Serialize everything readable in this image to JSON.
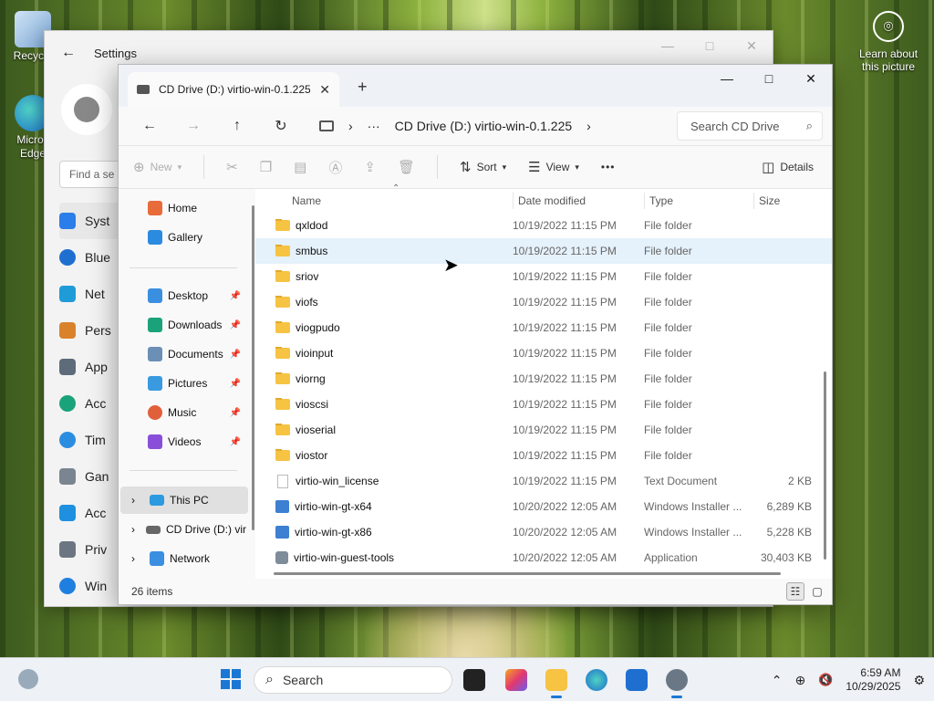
{
  "desktop": {
    "recycle_label": "Recycle",
    "edge_label": "Micros\nEdge",
    "learn_label": "Learn about this picture"
  },
  "settings": {
    "title": "Settings",
    "search_placeholder": "Find a se",
    "nav": [
      "Syst",
      "Blue",
      "Net",
      "Pers",
      "App",
      "Acc",
      "Tim",
      "Gan",
      "Acc",
      "Priv",
      "Win"
    ],
    "controls": [
      "—",
      "□",
      "✕"
    ]
  },
  "explorer": {
    "tab_title": "CD Drive (D:) virtio-win-0.1.225",
    "tab_close": "✕",
    "new_tab": "+",
    "controls": [
      "—",
      "□",
      "✕"
    ],
    "address": {
      "ellipsis": "···",
      "crumb": "CD Drive (D:) virtio-win-0.1.225",
      "search_placeholder": "Search CD Drive"
    },
    "toolbar": {
      "new": "New",
      "sort": "Sort",
      "view": "View",
      "more": "•••",
      "details": "Details"
    },
    "sidebar": {
      "home": "Home",
      "gallery": "Gallery",
      "desktop": "Desktop",
      "downloads": "Downloads",
      "documents": "Documents",
      "pictures": "Pictures",
      "music": "Music",
      "videos": "Videos",
      "this_pc": "This PC",
      "cd_drive": "CD Drive (D:) vir",
      "network": "Network"
    },
    "columns": {
      "name": "Name",
      "date": "Date modified",
      "type": "Type",
      "size": "Size"
    },
    "files": [
      {
        "name": "qxldod",
        "date": "10/19/2022 11:15 PM",
        "type": "File folder",
        "size": "",
        "kind": "folder"
      },
      {
        "name": "smbus",
        "date": "10/19/2022 11:15 PM",
        "type": "File folder",
        "size": "",
        "kind": "folder"
      },
      {
        "name": "sriov",
        "date": "10/19/2022 11:15 PM",
        "type": "File folder",
        "size": "",
        "kind": "folder"
      },
      {
        "name": "viofs",
        "date": "10/19/2022 11:15 PM",
        "type": "File folder",
        "size": "",
        "kind": "folder"
      },
      {
        "name": "viogpudo",
        "date": "10/19/2022 11:15 PM",
        "type": "File folder",
        "size": "",
        "kind": "folder"
      },
      {
        "name": "vioinput",
        "date": "10/19/2022 11:15 PM",
        "type": "File folder",
        "size": "",
        "kind": "folder"
      },
      {
        "name": "viorng",
        "date": "10/19/2022 11:15 PM",
        "type": "File folder",
        "size": "",
        "kind": "folder"
      },
      {
        "name": "vioscsi",
        "date": "10/19/2022 11:15 PM",
        "type": "File folder",
        "size": "",
        "kind": "folder"
      },
      {
        "name": "vioserial",
        "date": "10/19/2022 11:15 PM",
        "type": "File folder",
        "size": "",
        "kind": "folder"
      },
      {
        "name": "viostor",
        "date": "10/19/2022 11:15 PM",
        "type": "File folder",
        "size": "",
        "kind": "folder"
      },
      {
        "name": "virtio-win_license",
        "date": "10/19/2022 11:15 PM",
        "type": "Text Document",
        "size": "2 KB",
        "kind": "file"
      },
      {
        "name": "virtio-win-gt-x64",
        "date": "10/20/2022 12:05 AM",
        "type": "Windows Installer ...",
        "size": "6,289 KB",
        "kind": "msi"
      },
      {
        "name": "virtio-win-gt-x86",
        "date": "10/20/2022 12:05 AM",
        "type": "Windows Installer ...",
        "size": "5,228 KB",
        "kind": "msi"
      },
      {
        "name": "virtio-win-guest-tools",
        "date": "10/20/2022 12:05 AM",
        "type": "Application",
        "size": "30,403 KB",
        "kind": "exe"
      }
    ],
    "status": "26 items"
  },
  "taskbar": {
    "search_placeholder": "Search",
    "time": "6:59 AM",
    "date": "10/29/2025"
  },
  "colors": {
    "accent": "#1a78d4",
    "folder": "#f6c343",
    "hover_row": "#e5f1fb"
  }
}
